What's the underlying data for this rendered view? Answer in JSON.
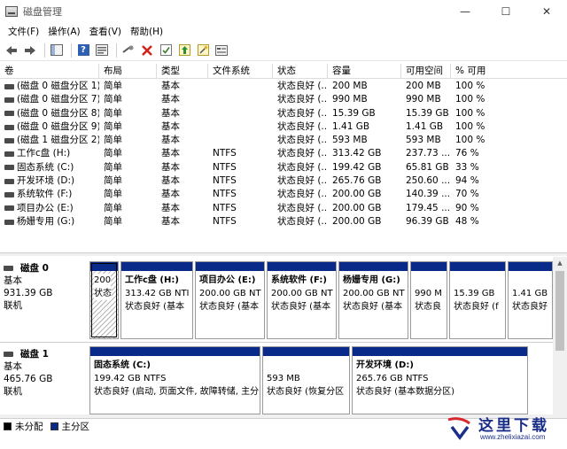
{
  "window": {
    "title": "磁盘管理",
    "controls": {
      "minimize": "—",
      "maximize": "☐",
      "close": "✕"
    }
  },
  "menu": [
    "文件(F)",
    "操作(A)",
    "查看(V)",
    "帮助(H)"
  ],
  "toolbar_icons": [
    "back-arrow-icon",
    "forward-arrow-icon",
    "console-tree-icon",
    "help-icon",
    "properties-icon",
    "connect-icon",
    "delete-icon",
    "check-icon",
    "up-arrow-icon",
    "wizard-icon",
    "disk-view-icon"
  ],
  "volume_table": {
    "columns": [
      "卷",
      "布局",
      "类型",
      "文件系统",
      "状态",
      "容量",
      "可用空间",
      "% 可用"
    ],
    "rows": [
      [
        "(磁盘 0 磁盘分区 1)",
        "简单",
        "基本",
        "",
        "状态良好 (...",
        "200 MB",
        "200 MB",
        "100 %"
      ],
      [
        "(磁盘 0 磁盘分区 7)",
        "简单",
        "基本",
        "",
        "状态良好 (...",
        "990 MB",
        "990 MB",
        "100 %"
      ],
      [
        "(磁盘 0 磁盘分区 8)",
        "简单",
        "基本",
        "",
        "状态良好 (...",
        "15.39 GB",
        "15.39 GB",
        "100 %"
      ],
      [
        "(磁盘 0 磁盘分区 9)",
        "简单",
        "基本",
        "",
        "状态良好 (...",
        "1.41 GB",
        "1.41 GB",
        "100 %"
      ],
      [
        "(磁盘 1 磁盘分区 2)",
        "简单",
        "基本",
        "",
        "状态良好 (...",
        "593 MB",
        "593 MB",
        "100 %"
      ],
      [
        "工作c盘 (H:)",
        "简单",
        "基本",
        "NTFS",
        "状态良好 (...",
        "313.42 GB",
        "237.73 ...",
        "76 %"
      ],
      [
        "固态系统 (C:)",
        "简单",
        "基本",
        "NTFS",
        "状态良好 (...",
        "199.42 GB",
        "65.81 GB",
        "33 %"
      ],
      [
        "开发环境 (D:)",
        "简单",
        "基本",
        "NTFS",
        "状态良好 (...",
        "265.76 GB",
        "250.60 ...",
        "94 %"
      ],
      [
        "系统软件 (F:)",
        "简单",
        "基本",
        "NTFS",
        "状态良好 (...",
        "200.00 GB",
        "140.39 ...",
        "70 %"
      ],
      [
        "项目办公 (E:)",
        "简单",
        "基本",
        "NTFS",
        "状态良好 (...",
        "200.00 GB",
        "179.45 ...",
        "90 %"
      ],
      [
        "杨姗专用 (G:)",
        "简单",
        "基本",
        "NTFS",
        "状态良好 (...",
        "200.00 GB",
        "96.39 GB",
        "48 %"
      ]
    ]
  },
  "disks": [
    {
      "name": "磁盘 0",
      "type": "基本",
      "size": "931.39 GB",
      "status": "联机",
      "partitions": [
        {
          "name": "",
          "size": "200",
          "status": "状态",
          "hatched": true
        },
        {
          "name": "工作c盘 (H:)",
          "size": "313.42 GB NTI",
          "status": "状态良好 (基本"
        },
        {
          "name": "项目办公 (E:)",
          "size": "200.00 GB NT",
          "status": "状态良好 (基本"
        },
        {
          "name": "系统软件 (F:)",
          "size": "200.00 GB NT",
          "status": "状态良好 (基本"
        },
        {
          "name": "杨姗专用 (G:)",
          "size": "200.00 GB NT",
          "status": "状态良好 (基本"
        },
        {
          "name": "",
          "size": "990 M",
          "status": "状态良"
        },
        {
          "name": "",
          "size": "15.39 GB",
          "status": "状态良好 (f"
        },
        {
          "name": "",
          "size": "1.41 GB",
          "status": "状态良好"
        }
      ]
    },
    {
      "name": "磁盘 1",
      "type": "基本",
      "size": "465.76 GB",
      "status": "联机",
      "partitions": [
        {
          "name": "固态系统 (C:)",
          "size": "199.42 GB NTFS",
          "status": "状态良好 (启动, 页面文件, 故障转储, 主分"
        },
        {
          "name": "",
          "size": "593 MB",
          "status": "状态良好 (恢复分区"
        },
        {
          "name": "开发环境 (D:)",
          "size": "265.76 GB NTFS",
          "status": "状态良好 (基本数据分区)"
        }
      ]
    }
  ],
  "legend": [
    {
      "label": "未分配",
      "color": "#000000"
    },
    {
      "label": "主分区",
      "color": "#0a2a8a"
    }
  ],
  "watermark": {
    "text": "这里下载",
    "url": "www.zhelixiazai.com"
  },
  "colors": {
    "primary_partition": "#0a2a8a",
    "unallocated": "#000000"
  }
}
